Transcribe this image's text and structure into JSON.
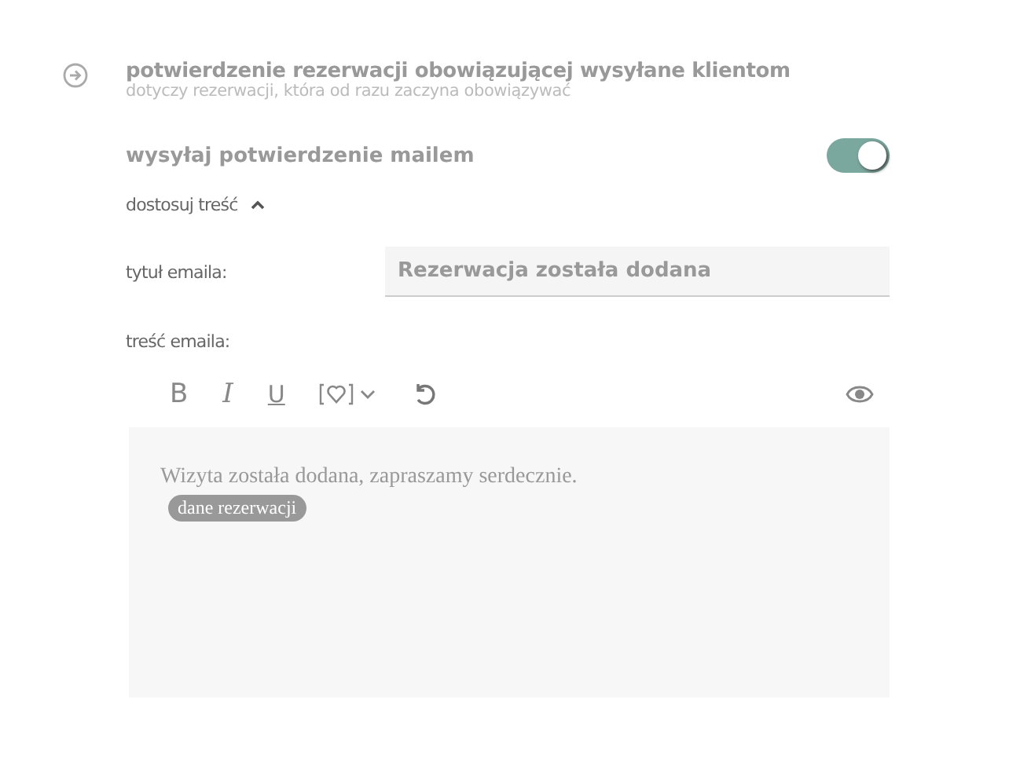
{
  "section": {
    "title": "potwierdzenie rezerwacji obowiązującej wysyłane klientom",
    "subtitle": "dotyczy rezerwacji, która od razu zaczyna obowiązywać"
  },
  "email_toggle": {
    "label": "wysyłaj potwierdzenie mailem",
    "on": true
  },
  "customize": {
    "label": "dostosuj treść",
    "expanded": true
  },
  "subject": {
    "label": "tytuł emaila:",
    "value": "Rezerwacja została dodana"
  },
  "body": {
    "label": "treść emaila:",
    "text": "Wizyta została dodana, zapraszamy serdecznie.",
    "chip": "dane rezerwacji"
  },
  "toolbar": [
    {
      "kind": "bold",
      "label": "B"
    },
    {
      "kind": "italic",
      "label": "I"
    },
    {
      "kind": "underline",
      "label": "U"
    },
    {
      "kind": "tag"
    },
    {
      "kind": "undo"
    },
    {
      "kind": "preview"
    }
  ]
}
